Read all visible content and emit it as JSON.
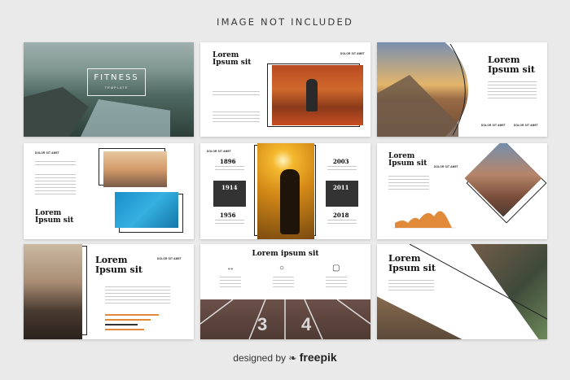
{
  "banner": "IMAGE NOT INCLUDED",
  "footer": {
    "prefix": "designed by",
    "brand": "freepik"
  },
  "slide1": {
    "title": "FITNESS",
    "subtitle": "TEMPLATE"
  },
  "slide2": {
    "title_line1": "Lorem",
    "title_line2": "Ipsum sit",
    "tag": "DOLOR SIT AMET"
  },
  "slide3": {
    "title_line1": "Lorem",
    "title_line2": "Ipsum sit",
    "tag_left": "DOLOR SIT AMET",
    "tag_right": "DOLOR SIT AMET"
  },
  "slide4": {
    "tag": "DOLOR SIT AMET",
    "title_line1": "Lorem",
    "title_line2": "Ipsum sit"
  },
  "slide5": {
    "tag": "DOLOR SIT AMET",
    "years": [
      "1896",
      "1914",
      "1956",
      "2003",
      "2011",
      "2018"
    ]
  },
  "slide6": {
    "title_line1": "Lorem",
    "title_line2": "Ipsum sit",
    "tag": "DOLOR SIT AMET"
  },
  "slide7": {
    "title_line1": "Lorem",
    "title_line2": "Ipsum sit",
    "tag": "DOLOR SIT AMET"
  },
  "slide8": {
    "title": "Lorem ipsum sit",
    "lane_numbers": [
      "3",
      "4"
    ],
    "icons": [
      "dumbbell-icon",
      "apple-icon",
      "scale-icon"
    ]
  },
  "slide9": {
    "title_line1": "Lorem",
    "title_line2": "Ipsum sit"
  },
  "colors": {
    "accent": "#e08a3a",
    "dark": "#222222"
  }
}
